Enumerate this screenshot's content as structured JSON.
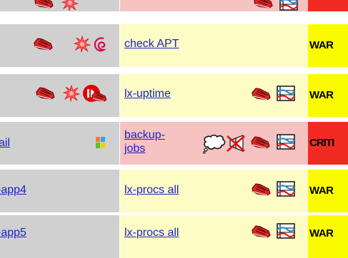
{
  "rows": [
    {
      "host": "",
      "service": "",
      "status": ""
    },
    {
      "host": "",
      "service": "check APT",
      "status": "WAR"
    },
    {
      "host": "",
      "service": "lx-uptime",
      "status": "WAR"
    },
    {
      "host": "ail",
      "service": "backup-jobs",
      "service_lines": [
        "backup-",
        "jobs"
      ],
      "status": "CRITI"
    },
    {
      "host": "-app4",
      "service": "lx-procs all",
      "status": "WAR"
    },
    {
      "host": "-app5",
      "service": "lx-procs all",
      "status": "WAR"
    }
  ],
  "icons": {
    "host_icons": [
      "notifications-off-icon",
      "flapping-icon",
      "debian-logo-icon",
      "passive-check-icon",
      "windows-logo-icon"
    ],
    "service_icons": [
      "notifications-off-icon",
      "performance-graph-icon",
      "comment-icon",
      "disabled-notification-icon"
    ]
  },
  "colors": {
    "host_bg": "#d0d0d0",
    "warn_row": "#fdfcc4",
    "crit_row": "#f6c2c2",
    "warn_status": "#fbfb00",
    "crit_status": "#f22b22",
    "link": "#1a23c7"
  }
}
